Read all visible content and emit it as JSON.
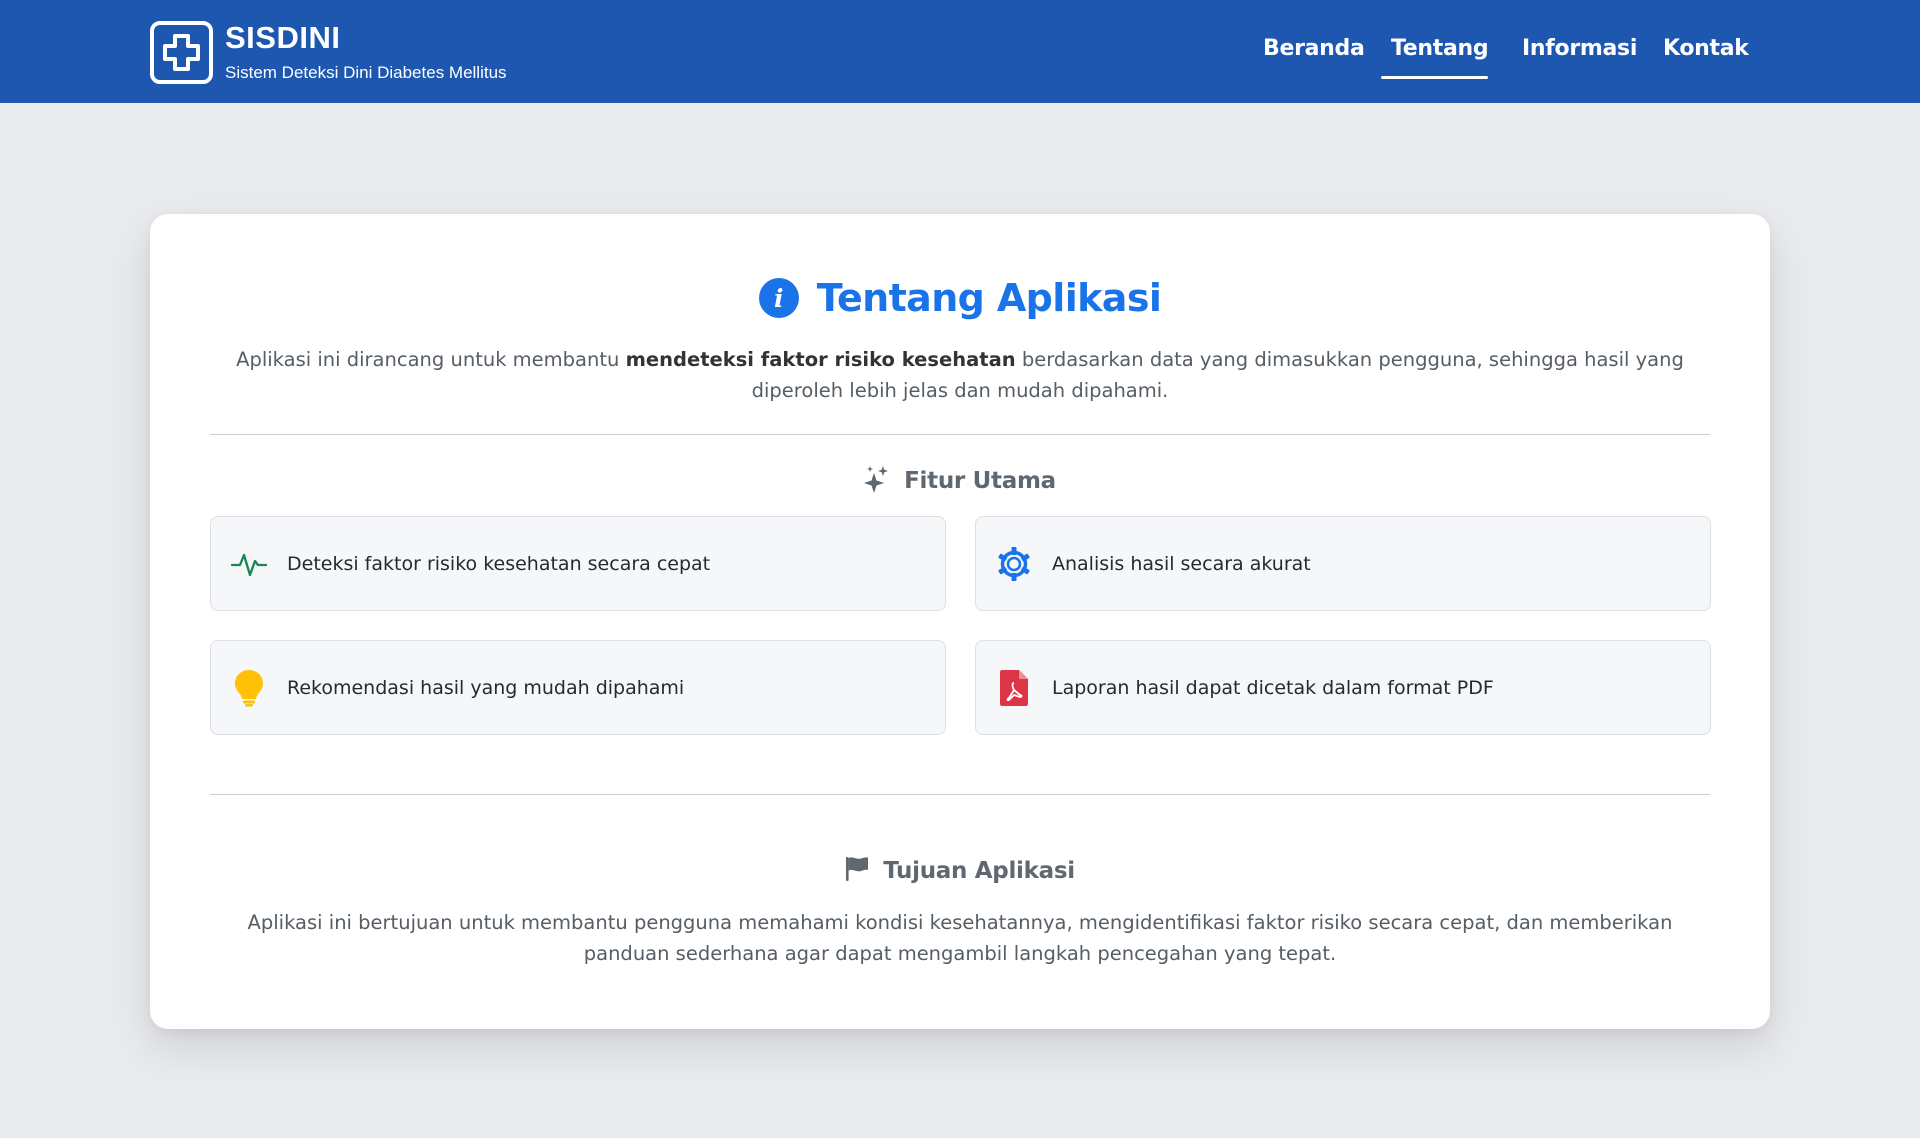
{
  "header": {
    "brand_title": "SISDINI",
    "brand_subtitle": "Sistem Deteksi Dini Diabetes Mellitus",
    "nav": [
      {
        "label": "Beranda",
        "active": false
      },
      {
        "label": "Tentang",
        "active": true
      },
      {
        "label": "Informasi",
        "active": false
      },
      {
        "label": "Kontak",
        "active": false
      }
    ]
  },
  "main": {
    "title": "Tentang Aplikasi",
    "intro_before": "Aplikasi ini dirancang untuk membantu ",
    "intro_bold": "mendeteksi faktor risiko kesehatan",
    "intro_after": " berdasarkan data yang dimasukkan pengguna, sehingga hasil yang diperoleh lebih jelas dan mudah dipahami.",
    "features_title": "Fitur Utama",
    "features": [
      {
        "label": "Deteksi faktor risiko kesehatan secara cepat",
        "icon": "activity-icon"
      },
      {
        "label": "Analisis hasil secara akurat",
        "icon": "gear-icon"
      },
      {
        "label": "Rekomendasi hasil yang mudah dipahami",
        "icon": "lightbulb-icon"
      },
      {
        "label": "Laporan hasil dapat dicetak dalam format PDF",
        "icon": "pdf-file-icon"
      }
    ],
    "goal_title": "Tujuan Aplikasi",
    "goal_text": "Aplikasi ini bertujuan untuk membantu pengguna memahami kondisi kesehatannya, mengidentifikasi faktor risiko secara cepat, dan memberikan panduan sederhana agar dapat mengambil langkah pencegahan yang tepat."
  },
  "colors": {
    "navbar": "#1e57b0",
    "accent": "#1a73e8",
    "background": "#e9ebee",
    "activity_icon": "#198754",
    "lightbulb_icon": "#ffc107",
    "pdf_icon": "#dc3545"
  }
}
